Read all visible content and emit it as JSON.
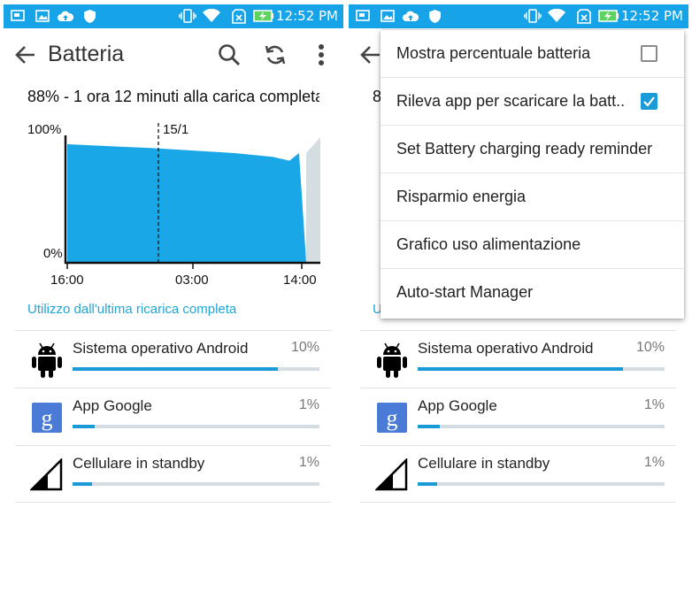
{
  "status_bar": {
    "time": "12:52 PM"
  },
  "app_bar": {
    "title": "Batteria"
  },
  "summary_text": "88% - 1 ora 12 minuti alla carica completa",
  "chart_data": {
    "type": "area",
    "y_tick_labels": [
      "100%",
      "0%"
    ],
    "x_tick_labels": [
      "16:00",
      "03:00",
      "14:00"
    ],
    "date_marker": "15/1",
    "points": [
      [
        0,
        93
      ],
      [
        0.35,
        90
      ],
      [
        0.7,
        86
      ],
      [
        0.86,
        83
      ],
      [
        0.93,
        80
      ],
      [
        0.97,
        86
      ]
    ],
    "ylim": [
      0,
      100
    ]
  },
  "section_header": "Utilizzo dall'ultima ricarica completa",
  "usage_items": [
    {
      "name": "Sistema operativo Android",
      "percent": "10%",
      "bar_fraction": 0.83,
      "icon": "android-robot-icon"
    },
    {
      "name": "App Google",
      "percent": "1%",
      "bar_fraction": 0.09,
      "icon": "google-g-icon"
    },
    {
      "name": "Cellulare in standby",
      "percent": "1%",
      "bar_fraction": 0.08,
      "icon": "cell-signal-icon"
    }
  ],
  "overflow_menu": {
    "items": [
      {
        "label": "Mostra percentuale batteria",
        "checkbox": true,
        "checked": false
      },
      {
        "label": "Rileva app per scaricare la batt..",
        "checkbox": true,
        "checked": true
      },
      {
        "label": "Set Battery charging ready reminder",
        "checkbox": false
      },
      {
        "label": "Risparmio energia",
        "checkbox": false
      },
      {
        "label": "Grafico uso alimentazione",
        "checkbox": false
      },
      {
        "label": "Auto-start Manager",
        "checkbox": false
      }
    ]
  },
  "colors": {
    "status_bar": "#16a3e8",
    "chart_fill": "#19a7e8",
    "accent": "#20a6d6",
    "bar_fill": "#1a9ad6",
    "bar_track": "#d6dde2"
  }
}
